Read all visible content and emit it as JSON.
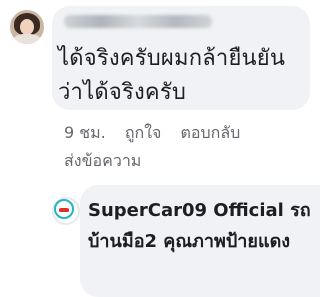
{
  "comment": {
    "text": "ได้จริงครับผมกล้ายืนยันว่าได้จริงครับ",
    "time": "9 ชม.",
    "like_label": "ถูกใจ",
    "reply_label": "ตอบกลับ",
    "send_message_label": "ส่งข้อความ"
  },
  "reply": {
    "author": "SuperCar09 Official",
    "text_start": "รถ",
    "text_rest": "บ้านมือ2 คุณภาพป้ายแดง"
  }
}
